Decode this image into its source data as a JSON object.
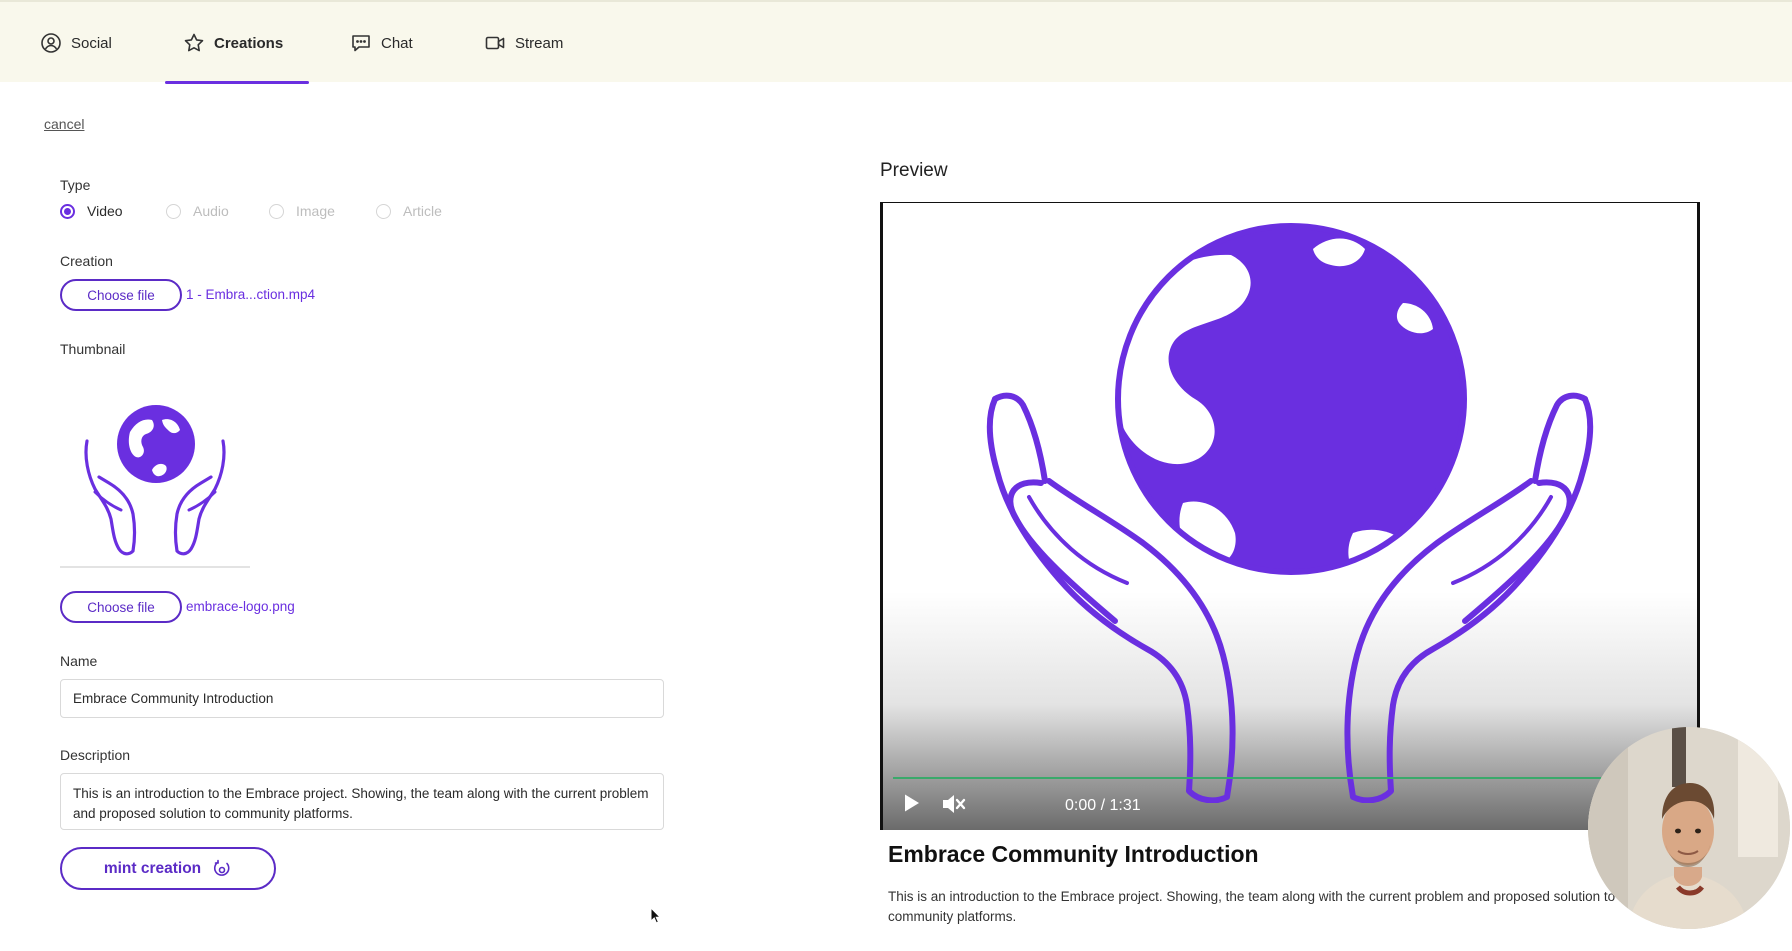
{
  "nav": {
    "tabs": [
      {
        "label": "Social",
        "icon": "user-circle-icon"
      },
      {
        "label": "Creations",
        "icon": "star-icon",
        "active": true
      },
      {
        "label": "Chat",
        "icon": "chat-bubble-icon"
      },
      {
        "label": "Stream",
        "icon": "video-camera-icon"
      }
    ]
  },
  "form": {
    "cancel_label": "cancel",
    "type_label": "Type",
    "type_options": [
      {
        "label": "Video",
        "selected": true
      },
      {
        "label": "Audio",
        "selected": false
      },
      {
        "label": "Image",
        "selected": false
      },
      {
        "label": "Article",
        "selected": false
      }
    ],
    "creation_label": "Creation",
    "creation_button": "Choose file",
    "creation_file": "1 - Embra...ction.mp4",
    "thumbnail_label": "Thumbnail",
    "thumbnail_button": "Choose file",
    "thumbnail_file": "embrace-logo.png",
    "name_label": "Name",
    "name_value": "Embrace Community Introduction",
    "description_label": "Description",
    "description_value": "This is an introduction to the Embrace project.  Showing, the team along with the current problem and proposed solution to community platforms.",
    "mint_label": "mint creation"
  },
  "preview": {
    "title": "Preview",
    "time": "0:00 / 1:31",
    "progress": 0,
    "video_title": "Embrace Community Introduction",
    "video_description": "This is an introduction to the Embrace project. Showing, the team along with the current problem and proposed solution to community platforms."
  },
  "colors": {
    "accent": "#6a2fe0",
    "nav_bg": "#f9f8ec",
    "progress": "#3aa96b"
  }
}
